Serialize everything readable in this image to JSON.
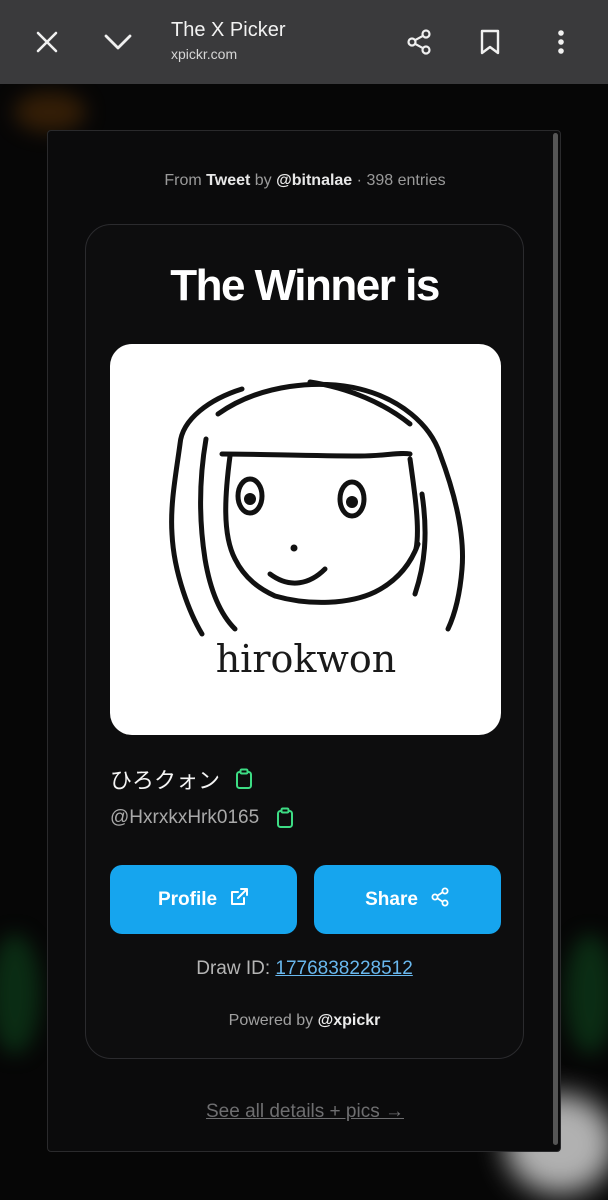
{
  "browser": {
    "title": "The X Picker",
    "url": "xpickr.com"
  },
  "source": {
    "from_label": "From",
    "type": "Tweet",
    "by_label": "by",
    "author": "@bitnalae",
    "separator": "·",
    "entries": "398 entries"
  },
  "winner": {
    "heading": "The Winner is",
    "display_name": "ひろクォン",
    "handle": "@HxrxkxHrk0165",
    "pic_text": "hirokwon"
  },
  "actions": {
    "profile_label": "Profile",
    "share_label": "Share"
  },
  "draw": {
    "label": "Draw ID:",
    "id": "1776838228512"
  },
  "footer": {
    "powered_label": "Powered by",
    "powered_brand": "@xpickr",
    "details_link": "See all details + pics →"
  },
  "colors": {
    "topbar": "#3a3a3c",
    "button": "#16a5ee",
    "link": "#69b8ee",
    "copy_icon": "#3ddc84"
  }
}
